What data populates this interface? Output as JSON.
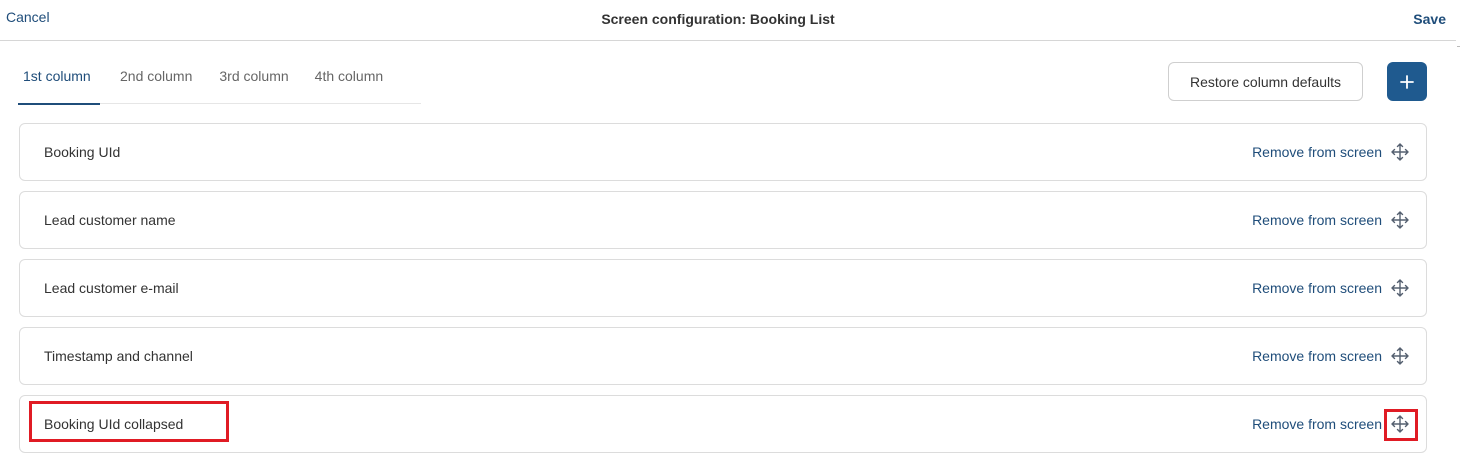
{
  "header": {
    "cancel_label": "Cancel",
    "title": "Screen configuration: Booking List",
    "save_label": "Save"
  },
  "tabs": [
    {
      "label": "1st column",
      "active": true
    },
    {
      "label": "2nd column",
      "active": false
    },
    {
      "label": "3rd column",
      "active": false
    },
    {
      "label": "4th column",
      "active": false
    }
  ],
  "toolbar": {
    "restore_label": "Restore column defaults",
    "add_icon": "plus-icon"
  },
  "rows": [
    {
      "label": "Booking UId",
      "action": "Remove from screen",
      "handle_icon": "move-icon"
    },
    {
      "label": "Lead customer name",
      "action": "Remove from screen",
      "handle_icon": "move-icon"
    },
    {
      "label": "Lead customer e-mail",
      "action": "Remove from screen",
      "handle_icon": "move-icon"
    },
    {
      "label": "Timestamp and channel",
      "action": "Remove from screen",
      "handle_icon": "move-icon"
    },
    {
      "label": "Booking UId collapsed",
      "action": "Remove from screen",
      "handle_icon": "move-icon"
    }
  ],
  "colors": {
    "accent": "#1f4d7a",
    "button_primary": "#1f5a8f",
    "highlight": "#e01b24"
  }
}
